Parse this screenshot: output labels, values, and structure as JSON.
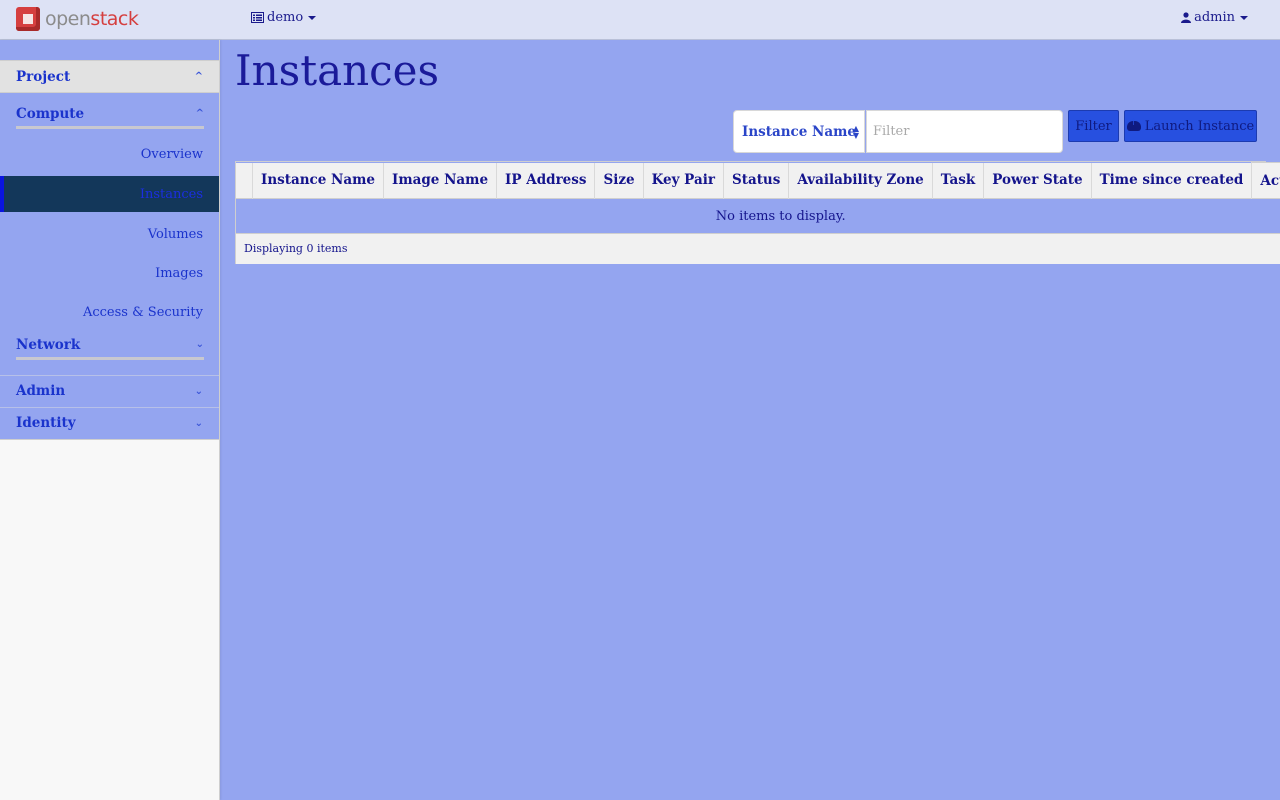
{
  "brand": {
    "logo_open": "open",
    "logo_stack": "stack",
    "color_red": "#d53f3f"
  },
  "topbar": {
    "project_icon": "list-icon",
    "project_label": "demo",
    "user_icon": "user-icon",
    "user_label": "admin"
  },
  "sidebar": {
    "project": "Project",
    "compute": "Compute",
    "compute_items": [
      {
        "label": "Overview",
        "active": false
      },
      {
        "label": "Instances",
        "active": true
      },
      {
        "label": "Volumes",
        "active": false
      },
      {
        "label": "Images",
        "active": false
      },
      {
        "label": "Access & Security",
        "active": false
      }
    ],
    "network": "Network",
    "admin": "Admin",
    "identity": "Identity"
  },
  "main": {
    "title": "Instances",
    "filter_select": "Instance Name",
    "filter_placeholder": "Filter",
    "filter_button": "Filter",
    "launch_button": "Launch Instance",
    "columns": [
      "",
      "Instance Name",
      "Image Name",
      "IP Address",
      "Size",
      "Key Pair",
      "Status",
      "Availability Zone",
      "Task",
      "Power State",
      "Time since created",
      "Actions"
    ],
    "empty_message": "No items to display.",
    "footer": "Displaying 0 items"
  },
  "colors": {
    "background": "#94a5f0",
    "topbar": "#dde2f5",
    "active_item": "#13375a",
    "button": "#2750e0"
  }
}
